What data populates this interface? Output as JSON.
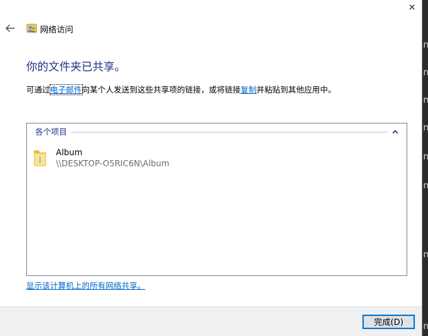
{
  "window": {
    "close_glyph": "✕",
    "title": "网络访问"
  },
  "main": {
    "heading": "你的文件夹已共享。",
    "desc_before": "可通过",
    "desc_link_email": "电子邮件",
    "desc_middle": "向某个人发送到这些共享项的链接，或将链接",
    "desc_link_copy": "复制",
    "desc_after": "并粘贴到其他应用中。"
  },
  "items_group": {
    "label": "各个项目",
    "items": [
      {
        "name": "Album",
        "path": "\\\\DESKTOP-O5RIC6N\\Album"
      }
    ]
  },
  "footer": {
    "link": "显示该计算机上的所有网络共享。",
    "done_label": "完成(D)"
  },
  "background_fragments": [
    "n",
    "n",
    "n",
    "n",
    "n",
    "n",
    "n",
    "n"
  ],
  "colors": {
    "heading": "#1e3287",
    "link": "#0066cc",
    "accent": "#0078d7"
  }
}
